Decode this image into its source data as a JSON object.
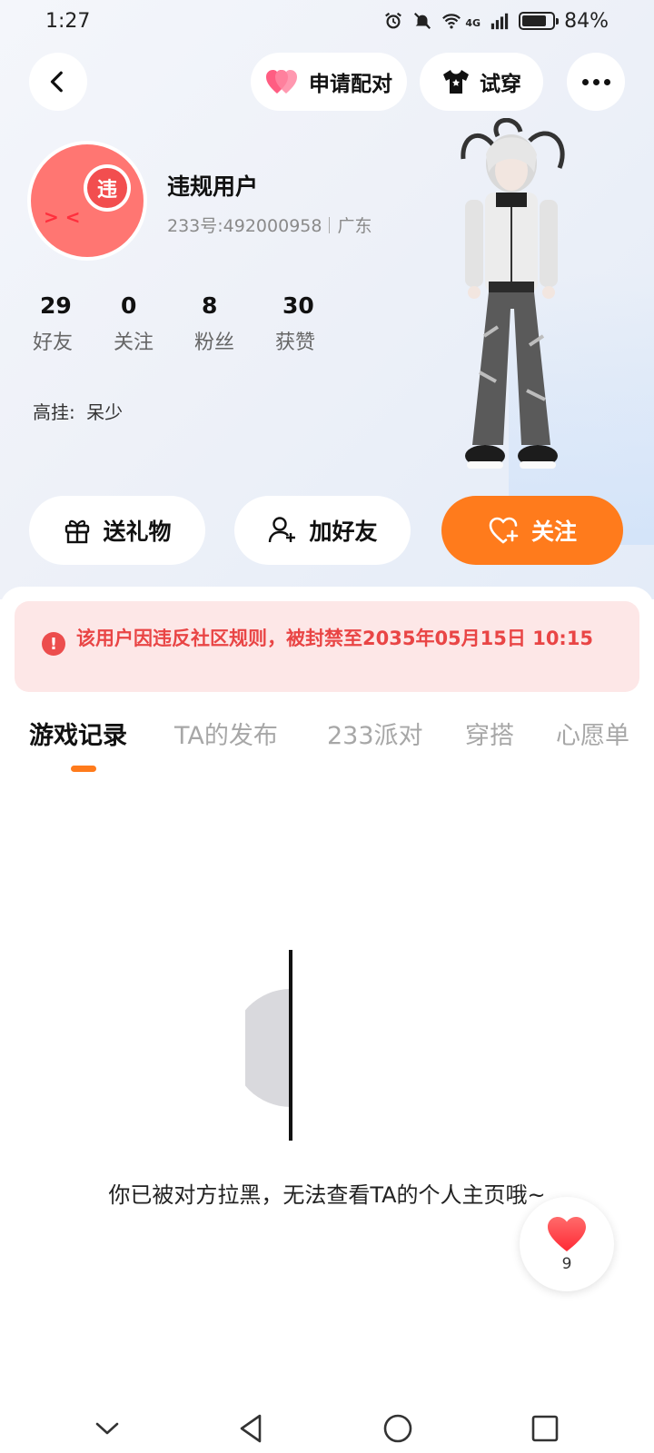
{
  "status_bar": {
    "time": "1:27",
    "network": "4G",
    "battery": "84%"
  },
  "top_bar": {
    "match_label": "申请配对",
    "tryon_label": "试穿"
  },
  "profile": {
    "avatar_badge": "违",
    "name": "违规用户",
    "id_text": "233号:492000958",
    "location": "广东",
    "stats": [
      {
        "value": "29",
        "label": "好友"
      },
      {
        "value": "0",
        "label": "关注"
      },
      {
        "value": "8",
        "label": "粉丝"
      },
      {
        "value": "30",
        "label": "获赞"
      }
    ],
    "status_prefix": "高挂:",
    "status_value": "呆少"
  },
  "actions": {
    "gift": "送礼物",
    "add_friend": "加好友",
    "follow": "关注"
  },
  "ban_notice": {
    "icon": "!",
    "text": "该用户因违反社区规则，被封禁至2035年05月15日 10:15"
  },
  "tabs": [
    {
      "label": "游戏记录",
      "active": true
    },
    {
      "label": "TA的发布",
      "active": false
    },
    {
      "label": "233派对",
      "active": false
    },
    {
      "label": "穿搭",
      "active": false
    },
    {
      "label": "心愿单",
      "active": false
    }
  ],
  "empty_state": {
    "text": "你已被对方拉黑，无法查看TA的个人主页哦~"
  },
  "like_fab": {
    "count": "9"
  },
  "colors": {
    "accent_orange": "#ff7b1c",
    "ban_red": "#e94545",
    "ban_bg": "#fde7e7",
    "avatar_pink": "#ff7672"
  }
}
